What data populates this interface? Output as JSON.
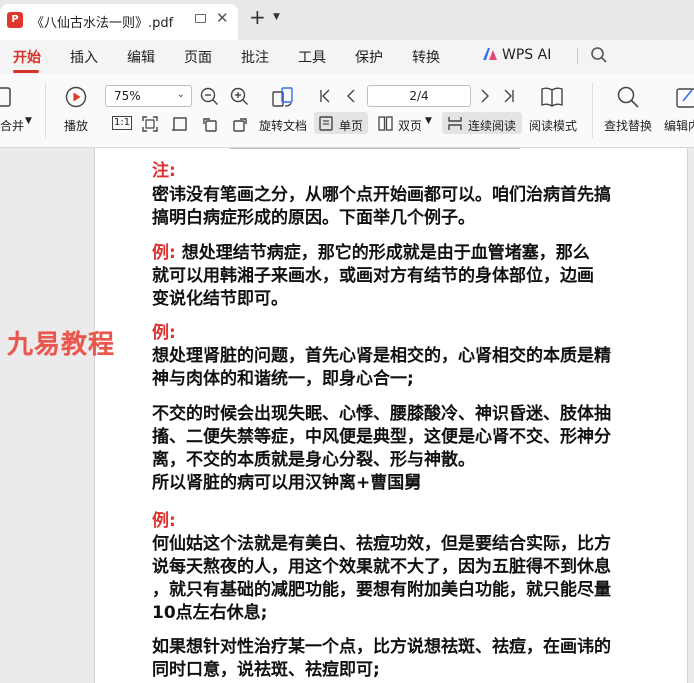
{
  "window": {
    "tab_title": "《八仙古水法一则》.pdf",
    "close_glyph": "✕",
    "newtab_glyph": "+",
    "dropdown_glyph": "⌄"
  },
  "menu": {
    "items": [
      "开始",
      "插入",
      "编辑",
      "页面",
      "批注",
      "工具",
      "保护",
      "转换"
    ],
    "active": "开始",
    "wps_ai": "WPS AI"
  },
  "toolbar": {
    "merge_label": "合并",
    "play_label": "播放",
    "zoom_value": "75%",
    "zoom_arrow": "⌄",
    "rotate_label": "旋转文档",
    "single_page_label": "单页",
    "double_page_label": "双页",
    "page_value": "2/4",
    "continuous_label": "连续阅读",
    "reading_mode_label": "阅读模式",
    "find_replace_label": "查找替换",
    "edit_label": "编辑内",
    "first_page_glyph": "|‹",
    "prev_glyph": "‹",
    "next_glyph": "›",
    "last_page_glyph": "›|",
    "actual_size_glyph": "1:1",
    "double_page_dd": "⌄",
    "merge_dd": "⌄"
  },
  "document": {
    "watermark": "九易教程",
    "lines": [
      {
        "text": "注:",
        "style": "red"
      },
      {
        "text": "密讳没有笔画之分，从哪个点开始画都可以。咱们治病首先搞"
      },
      {
        "text": "搞明白病症形成的原因。下面举几个例子。"
      },
      {
        "label": "例:",
        "text": " 想处理结节病症，那它的形成就是由于血管堵塞，那么"
      },
      {
        "text": "就可以用韩湘子来画水，或画对方有结节的身体部位，边画"
      },
      {
        "text": "变说化结节即可。"
      },
      {
        "text": "例:",
        "style": "red"
      },
      {
        "text": "想处理肾脏的问题，首先心肾是相交的，心肾相交的本质是精"
      },
      {
        "text": "神与肉体的和谐统一，即身心合一;"
      },
      {
        "text": "不交的时候会出现失眠、心悸、腰膝酸冷、神识昏迷、肢体抽"
      },
      {
        "text": "搐、二便失禁等症，中风便是典型，这便是心肾不交、形神分"
      },
      {
        "text": "离，不交的本质就是身心分裂、形与神散。"
      },
      {
        "text": "所以肾脏的病可以用汉钟离+曹国舅"
      },
      {
        "text": "例:",
        "style": "red"
      },
      {
        "text": "何仙姑这个法就是有美白、祛痘功效，但是要结合实际，比方"
      },
      {
        "text": "说每天熬夜的人，用这个效果就不大了，因为五脏得不到休息"
      },
      {
        "text": "，就只有基础的减肥功能，要想有附加美白功能，就只能尽量"
      },
      {
        "text": "10点左右休息;"
      },
      {
        "text": "如果想针对性治疗某一个点，比方说想祛斑、祛痘，在画讳的"
      },
      {
        "text": "同时口意，说祛斑、祛痘即可;"
      }
    ]
  }
}
